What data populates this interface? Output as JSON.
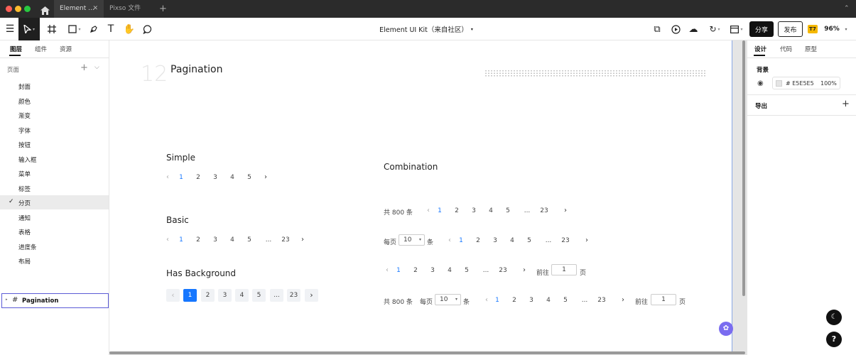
{
  "tabs": [
    {
      "label": "Element ..."
    },
    {
      "label": "Pixso 文件"
    }
  ],
  "toolbar": {
    "doc_title": "Element UI Kit（来自社区）",
    "share": "分享",
    "publish": "发布",
    "zoom": "96%",
    "badge": "T7"
  },
  "left": {
    "tabs": [
      "图层",
      "组件",
      "资源"
    ],
    "pages_label": "页面",
    "pages": [
      "封面",
      "颜色",
      "渐变",
      "字体",
      "按钮",
      "输入框",
      "菜单",
      "标签",
      "分页",
      "通知",
      "表格",
      "进度条",
      "布局"
    ],
    "active_page": "分页",
    "layer": "Pagination"
  },
  "right": {
    "tabs": [
      "设计",
      "代码",
      "原型"
    ],
    "bg_label": "背景",
    "bg_hex": "# E5E5E5",
    "bg_opacity": "100%",
    "export_label": "导出"
  },
  "canvas": {
    "number": "12",
    "title": "Pagination",
    "simple": {
      "title": "Simple",
      "pages": [
        "1",
        "2",
        "3",
        "4",
        "5"
      ]
    },
    "basic": {
      "title": "Basic",
      "pages": [
        "1",
        "2",
        "3",
        "4",
        "5",
        "...",
        "23"
      ]
    },
    "background": {
      "title": "Has Background",
      "pages": [
        "1",
        "2",
        "3",
        "4",
        "5",
        "...",
        "23"
      ]
    },
    "combination": {
      "title": "Combination",
      "total": "共 800 条",
      "per_page": "每页",
      "per_value": "10",
      "unit": "条",
      "goto": "前往",
      "goto_value": "1",
      "page_unit": "页",
      "pages": [
        "1",
        "2",
        "3",
        "4",
        "5",
        "...",
        "23"
      ]
    }
  },
  "colors": {
    "accent": "#1677ff",
    "canvas_bg": "#e5e5e5"
  }
}
